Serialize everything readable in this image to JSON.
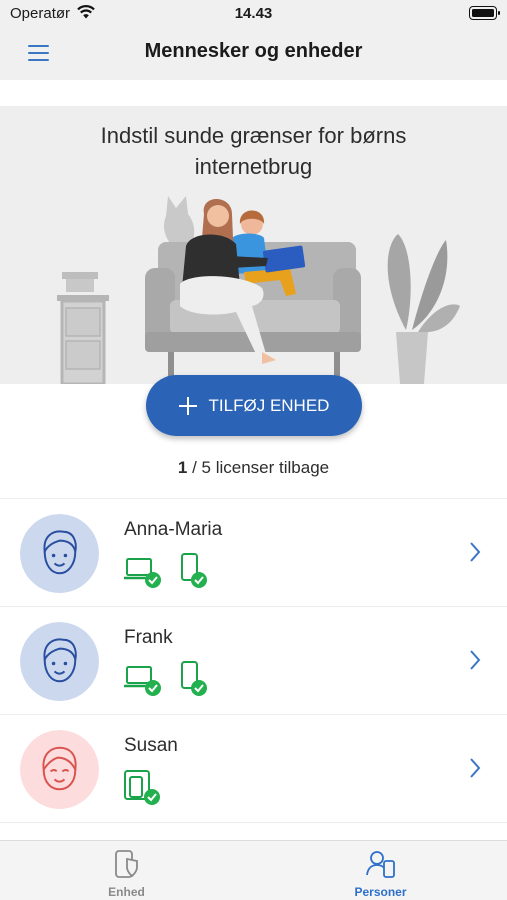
{
  "status_bar": {
    "carrier": "Operatør",
    "time": "14.43"
  },
  "nav": {
    "title": "Mennesker og enheder"
  },
  "hero": {
    "title": "Indstil sunde grænser for børns internetbrug"
  },
  "add_device": {
    "label": "TILFØJ ENHED"
  },
  "licenses": {
    "count": "1",
    "text": " / 5 licenser tilbage"
  },
  "people": [
    {
      "name": "Anna-Maria",
      "avatar": "boy-avatar-icon",
      "devices": [
        "laptop-protected-icon",
        "phone-protected-icon"
      ]
    },
    {
      "name": "Frank",
      "avatar": "boy-avatar-icon",
      "devices": [
        "laptop-protected-icon",
        "phone-protected-icon"
      ]
    },
    {
      "name": "Susan",
      "avatar": "girl-avatar-icon",
      "devices": [
        "tablet-phone-protected-icon"
      ]
    }
  ],
  "tabs": [
    {
      "label": "Enhed",
      "icon": "device-shield-icon",
      "active": false
    },
    {
      "label": "Personer",
      "icon": "people-device-icon",
      "active": true
    }
  ],
  "colors": {
    "accent": "#2b64b7",
    "tab_active": "#2e6fc9",
    "tab_inactive": "#8a8a8a",
    "device_green": "#1aa34a",
    "check_green": "#23b04f",
    "avatar_blue_bg": "#ccd8ee",
    "avatar_pink_bg": "#fcdcdc"
  }
}
